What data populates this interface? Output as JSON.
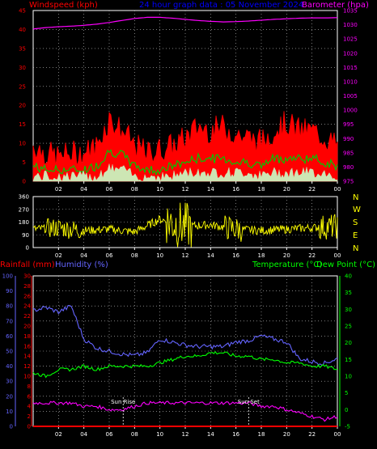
{
  "header": {
    "windspeed_label": "Windspeed (kph)",
    "title": "24 hour graph data : 05 November 2024",
    "barometer_label": "Barometer (hpa)"
  },
  "compass": {
    "letters": [
      "N",
      "W",
      "S",
      "E",
      "N"
    ]
  },
  "lower_labels": {
    "rainfall": "Rainfall (mm)",
    "humidity": "Humidity (%)",
    "temperature": "Temperature (°C)",
    "dew_point": "Dew Point (°C)"
  },
  "annotations": {
    "sun_rise": "Sun Rise",
    "sun_set": "Sun Set"
  },
  "colors": {
    "wind_gust": "#ff0000",
    "wind_avg": "#00c800",
    "wind_low": "#c8ffc8",
    "barometer": "#ff00ff",
    "direction": "#ffff00",
    "humidity": "#6464ff",
    "temperature": "#00ff00",
    "dew_point": "#ff00ff",
    "rainfall": "#ff0000",
    "title": "#0000ff",
    "grid": "#c8c8c8"
  },
  "chart_data": [
    {
      "type": "area",
      "id": "wind",
      "x": [
        "00",
        "01",
        "02",
        "03",
        "04",
        "05",
        "06",
        "07",
        "08",
        "09",
        "10",
        "11",
        "12",
        "13",
        "14",
        "15",
        "16",
        "17",
        "18",
        "19",
        "20",
        "21",
        "22",
        "23",
        "24"
      ],
      "x_ticks": [
        "02",
        "04",
        "06",
        "08",
        "10",
        "12",
        "14",
        "16",
        "18",
        "20",
        "22",
        "00"
      ],
      "ylim": [
        0,
        45
      ],
      "y_ticks": [
        "0",
        "5",
        "10",
        "15",
        "20",
        "25",
        "30",
        "35",
        "40",
        "45"
      ],
      "series": [
        {
          "name": "gust",
          "values": [
            8,
            6,
            5,
            6,
            6,
            8,
            15,
            12,
            8,
            6,
            7,
            8,
            10,
            13,
            12,
            13,
            11,
            10,
            9,
            12,
            14,
            12,
            12,
            10,
            8
          ]
        },
        {
          "name": "average",
          "values": [
            4,
            3,
            3,
            3,
            3,
            4,
            8,
            7,
            4,
            3,
            3,
            4,
            5,
            6,
            6,
            6,
            5,
            5,
            4,
            6,
            6,
            6,
            6,
            5,
            4
          ]
        },
        {
          "name": "low",
          "values": [
            1,
            1,
            1,
            1,
            1,
            1,
            3,
            3,
            1,
            1,
            1,
            1,
            2,
            2,
            2,
            2,
            2,
            2,
            1,
            2,
            2,
            2,
            2,
            2,
            1
          ]
        }
      ]
    },
    {
      "type": "line",
      "id": "barometer",
      "x": [
        "00",
        "01",
        "02",
        "03",
        "04",
        "05",
        "06",
        "07",
        "08",
        "09",
        "10",
        "11",
        "12",
        "13",
        "14",
        "15",
        "16",
        "17",
        "18",
        "19",
        "20",
        "21",
        "22",
        "23",
        "24"
      ],
      "ylim": [
        975,
        1035
      ],
      "y_ticks": [
        "975",
        "980",
        "985",
        "990",
        "995",
        "1000",
        "1005",
        "1010",
        "1015",
        "1020",
        "1025",
        "1030",
        "1035"
      ],
      "values": [
        1028.5,
        1029,
        1029.3,
        1029.5,
        1029.8,
        1030.2,
        1030.8,
        1031.5,
        1032.2,
        1032.6,
        1032.6,
        1032.3,
        1031.9,
        1031.5,
        1031.2,
        1031.0,
        1031.1,
        1031.3,
        1031.6,
        1031.9,
        1032.1,
        1032.3,
        1032.4,
        1032.4,
        1032.5
      ]
    },
    {
      "type": "line",
      "id": "wind_direction",
      "x": [
        "00",
        "02",
        "04",
        "06",
        "08",
        "10",
        "12",
        "14",
        "16",
        "18",
        "20",
        "22",
        "24"
      ],
      "x_ticks": [
        "02",
        "04",
        "06",
        "08",
        "10",
        "12",
        "14",
        "16",
        "18",
        "20",
        "22",
        "00"
      ],
      "ylim": [
        0,
        360
      ],
      "y_ticks": [
        "0",
        "90",
        "180",
        "270",
        "360"
      ],
      "values": [
        130,
        140,
        120,
        130,
        110,
        200,
        150,
        160,
        130,
        120,
        130,
        140,
        150
      ]
    },
    {
      "type": "line",
      "id": "weather",
      "x": [
        "00",
        "01",
        "02",
        "03",
        "04",
        "05",
        "06",
        "07",
        "08",
        "09",
        "10",
        "11",
        "12",
        "13",
        "14",
        "15",
        "16",
        "17",
        "18",
        "19",
        "20",
        "21",
        "22",
        "23",
        "24"
      ],
      "x_ticks": [
        "02",
        "04",
        "06",
        "08",
        "10",
        "12",
        "14",
        "16",
        "18",
        "20",
        "22",
        "00"
      ],
      "humidity_axis": {
        "ylim": [
          0,
          100
        ],
        "ticks": [
          "0",
          "10",
          "20",
          "30",
          "40",
          "50",
          "60",
          "70",
          "80",
          "90",
          "100"
        ]
      },
      "rainfall_axis": {
        "ylim": [
          0,
          30
        ],
        "ticks": [
          "0",
          "2",
          "4",
          "6",
          "8",
          "10",
          "12",
          "14",
          "16",
          "18",
          "20",
          "22",
          "24",
          "26",
          "28",
          "30"
        ]
      },
      "temperature_axis": {
        "ylim": [
          -5,
          40
        ],
        "ticks": [
          "-5",
          "0",
          "5",
          "10",
          "15",
          "20",
          "25",
          "30",
          "35",
          "40"
        ]
      },
      "series": [
        {
          "name": "Humidity (%)",
          "axis": "humidity",
          "values": [
            77,
            79,
            76,
            80,
            58,
            52,
            50,
            48,
            47,
            49,
            58,
            56,
            54,
            53,
            53,
            53,
            56,
            57,
            60,
            58,
            56,
            45,
            43,
            42,
            45
          ]
        },
        {
          "name": "Temperature (°C)",
          "axis": "temperature",
          "values": [
            11,
            10,
            12,
            12,
            13,
            12,
            13,
            13,
            13,
            13,
            14,
            15,
            16,
            16,
            17,
            17,
            16,
            16,
            15,
            15,
            14,
            14,
            13,
            13,
            12
          ]
        },
        {
          "name": "Dew Point (°C)",
          "axis": "temperature",
          "values": [
            2,
            2,
            2,
            2,
            1,
            1,
            0,
            0,
            1,
            2,
            2,
            2,
            2,
            2,
            2,
            2,
            2,
            2,
            1,
            1,
            0,
            -1,
            -2,
            -3,
            -2
          ]
        },
        {
          "name": "Rainfall (mm)",
          "axis": "rainfall",
          "values": [
            0,
            0,
            0,
            0,
            0,
            0,
            0,
            0,
            0,
            0,
            0,
            0,
            0,
            0,
            0,
            0,
            0,
            0,
            0,
            0,
            0,
            0,
            0,
            0,
            0
          ]
        }
      ],
      "sun_rise_hour": 7.1,
      "sun_set_hour": 17.0
    }
  ]
}
